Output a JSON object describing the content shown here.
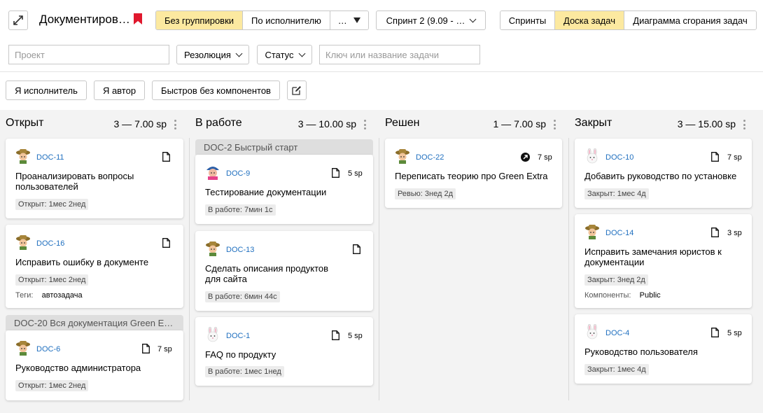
{
  "header": {
    "board_title": "Документиров…",
    "grouping": [
      "Без группировки",
      "По исполнителю",
      "…"
    ],
    "grouping_active": 0,
    "sprint": "Спринт 2 (9.09 - …",
    "views": [
      "Спринты",
      "Доска задач",
      "Диаграмма сгорания задач"
    ],
    "views_active": 1
  },
  "filters": {
    "project_placeholder": "Проект",
    "resolution_label": "Резолюция",
    "status_label": "Статус",
    "search_placeholder": "Ключ или название задачи"
  },
  "quick_filters": [
    "Я исполнитель",
    "Я автор",
    "Быстров без компонентов"
  ],
  "columns": [
    {
      "name": "Открыт",
      "count": "3 — 7.00 sp",
      "cards": [
        {
          "key": "DOC-11",
          "title": "Проанализировать вопросы пользователей",
          "status": "Открыт: 1мес 2нед"
        },
        {
          "key": "DOC-16",
          "title": "Исправить ошибку в документе",
          "status": "Открыт: 1мес 2нед",
          "meta_label": "Теги:",
          "meta_value": "автозадача"
        }
      ],
      "epic": "DOC-20 Вся документация Green E…",
      "epic_cards": [
        {
          "key": "DOC-6",
          "sp": "7 sp",
          "title": "Руководство администратора",
          "status": "Открыт: 1мес 2нед"
        }
      ]
    },
    {
      "name": "В работе",
      "count": "3 — 10.00 sp",
      "epic": "DOC-2 Быстрый старт",
      "epic_cards": [
        {
          "key": "DOC-9",
          "sp": "5 sp",
          "title": "Тестирование документации",
          "status": "В работе: 7мин 1с"
        }
      ],
      "cards": [
        {
          "key": "DOC-13",
          "title": "Сделать описания продуктов для сайта",
          "status": "В работе: 6мин 44с"
        },
        {
          "key": "DOC-1",
          "sp": "5 sp",
          "title": "FAQ по продукту",
          "status": "В работе: 1мес 1нед"
        }
      ]
    },
    {
      "name": "Решен",
      "count": "1 — 7.00 sp",
      "cards": [
        {
          "key": "DOC-22",
          "sp": "7 sp",
          "title": "Переписать теорию про Green Extra",
          "status": "Ревью: 3нед 2д"
        }
      ]
    },
    {
      "name": "Закрыт",
      "count": "3 — 15.00 sp",
      "cards": [
        {
          "key": "DOC-10",
          "sp": "7 sp",
          "title": "Добавить руководство по установке",
          "status": "Закрыт: 1мес 4д"
        },
        {
          "key": "DOC-14",
          "sp": "3 sp",
          "title": "Исправить замечания юристов к документации",
          "status": "Закрыт: 3нед 2д",
          "meta_label": "Компоненты:",
          "meta_value": "Public"
        },
        {
          "key": "DOC-4",
          "sp": "5 sp",
          "title": "Руководство пользователя",
          "status": "Закрыт: 1мес 4д"
        }
      ]
    }
  ],
  "colors": {
    "accent_yellow": "#fce9a0",
    "link_blue": "#1f6fbf",
    "bookmark_red": "#e0182d"
  }
}
